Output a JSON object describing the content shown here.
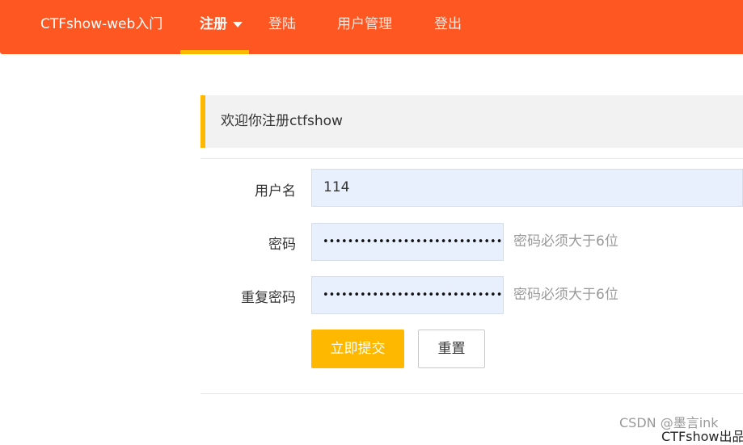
{
  "nav": {
    "brand": "CTFshow-web入门",
    "items": [
      {
        "label": "注册"
      },
      {
        "label": "登陆"
      },
      {
        "label": "用户管理"
      },
      {
        "label": "登出"
      }
    ]
  },
  "notice": {
    "text": "欢迎你注册ctfshow"
  },
  "form": {
    "username": {
      "label": "用户名",
      "value": "114"
    },
    "password": {
      "label": "密码",
      "value": "••••••••••••••••••••••••••••••••••",
      "hint": "密码必须大于6位"
    },
    "repeat_password": {
      "label": "重复密码",
      "value": "••••••••••••••••••••••••••••••••••",
      "hint": "密码必须大于6位"
    },
    "submit_label": "立即提交",
    "reset_label": "重置"
  },
  "footer": {
    "watermark": "CSDN @墨言ink",
    "text": "CTFshow出品"
  },
  "colors": {
    "header": "#ff5722",
    "accent": "#ffb800",
    "input_bg": "#e8f0fe"
  }
}
